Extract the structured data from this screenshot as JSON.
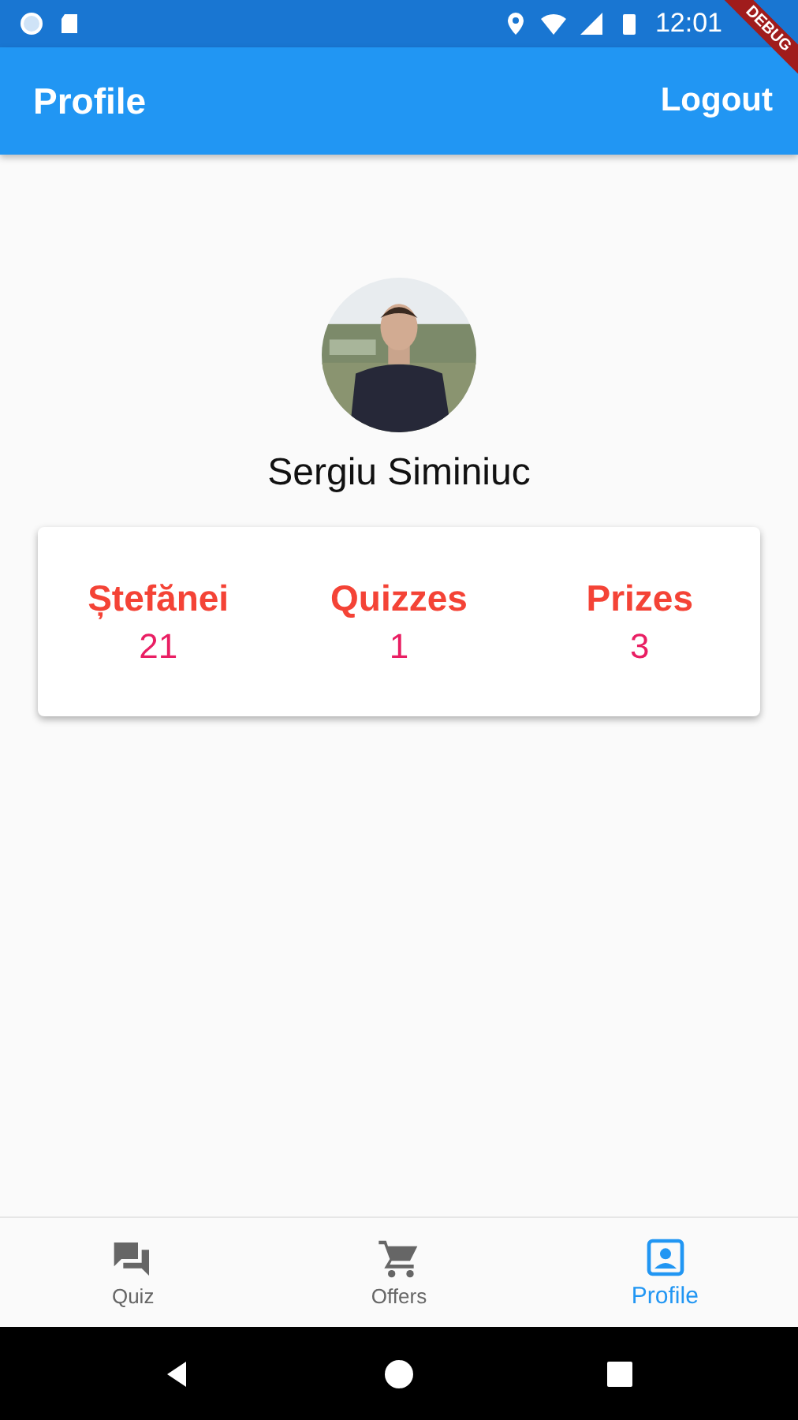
{
  "status_bar": {
    "time": "12:01"
  },
  "debug_banner": "DEBUG",
  "app_bar": {
    "title": "Profile",
    "action": "Logout"
  },
  "profile": {
    "name": "Sergiu Siminiuc"
  },
  "stats": [
    {
      "label": "Ștefănei",
      "value": "21"
    },
    {
      "label": "Quizzes",
      "value": "1"
    },
    {
      "label": "Prizes",
      "value": "3"
    }
  ],
  "bottom_nav": [
    {
      "label": "Quiz",
      "selected": false
    },
    {
      "label": "Offers",
      "selected": false
    },
    {
      "label": "Profile",
      "selected": true
    }
  ]
}
